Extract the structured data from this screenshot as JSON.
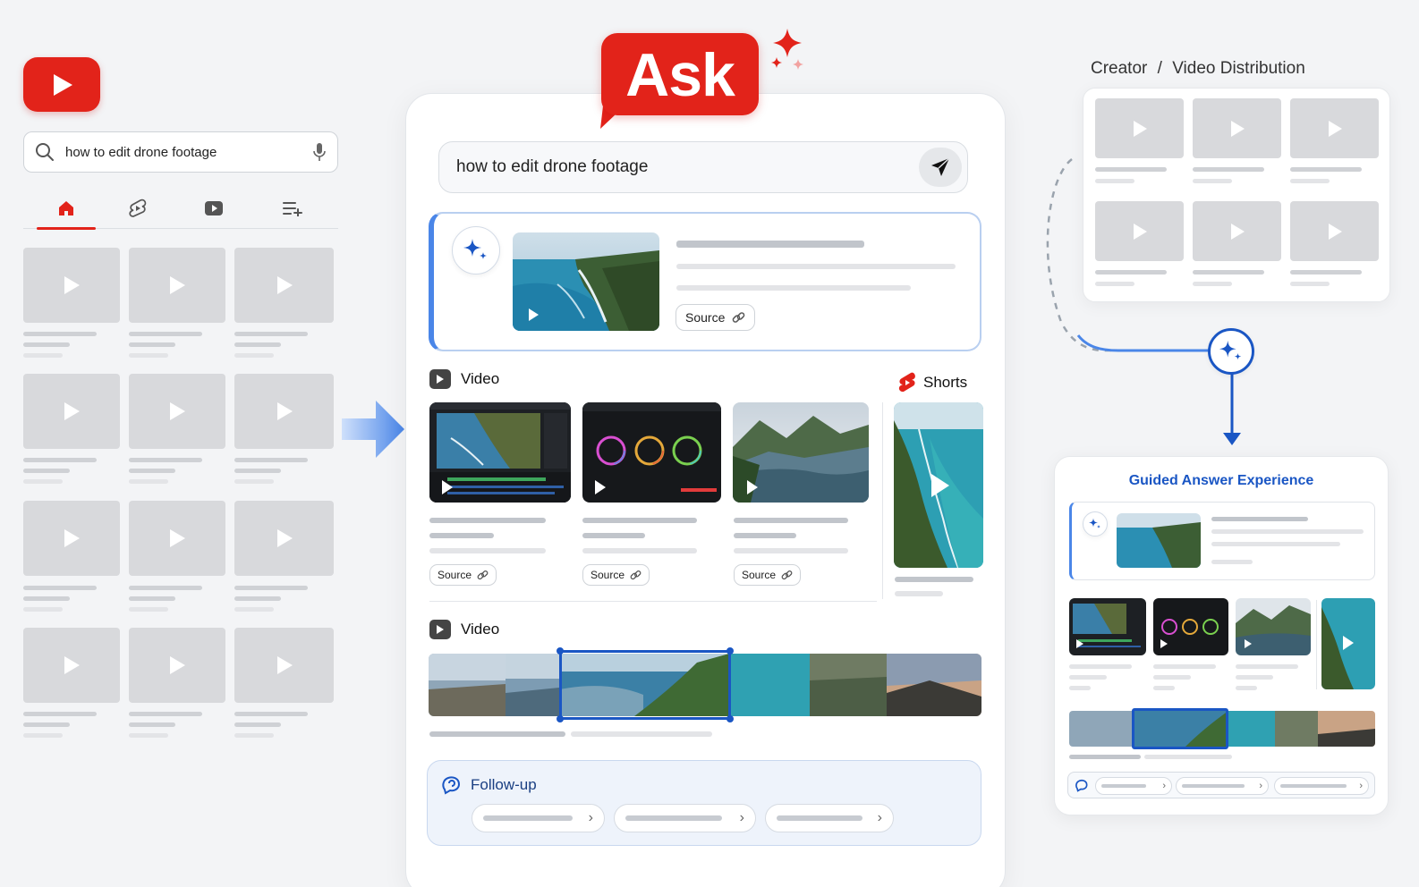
{
  "left_panel": {
    "search": {
      "query": "how to edit drone footage"
    },
    "tabs": [
      {
        "name": "home-icon"
      },
      {
        "name": "shorts-icon"
      },
      {
        "name": "subscriptions-icon"
      },
      {
        "name": "playlist-add-icon"
      }
    ]
  },
  "center": {
    "badge": "Ask",
    "search": {
      "query": "how to edit drone footage"
    },
    "answer": {
      "source_label": "Source"
    },
    "video_section": {
      "label": "Video"
    },
    "shorts_section": {
      "label": "Shorts"
    },
    "video_cards": [
      {
        "source_label": "Source"
      },
      {
        "source_label": "Source"
      },
      {
        "source_label": "Source"
      }
    ],
    "timeline_section": {
      "label": "Video"
    },
    "followup": {
      "label": "Follow-up"
    }
  },
  "right_panel": {
    "title_left": "Creator",
    "title_sep": "/",
    "title_right": "Video Distribution",
    "guided": {
      "title": "Guided Answer Experience"
    }
  },
  "colors": {
    "brand_red": "#e2231a",
    "accent_blue": "#1a56c4",
    "highlight_blue": "#4a86e8"
  }
}
